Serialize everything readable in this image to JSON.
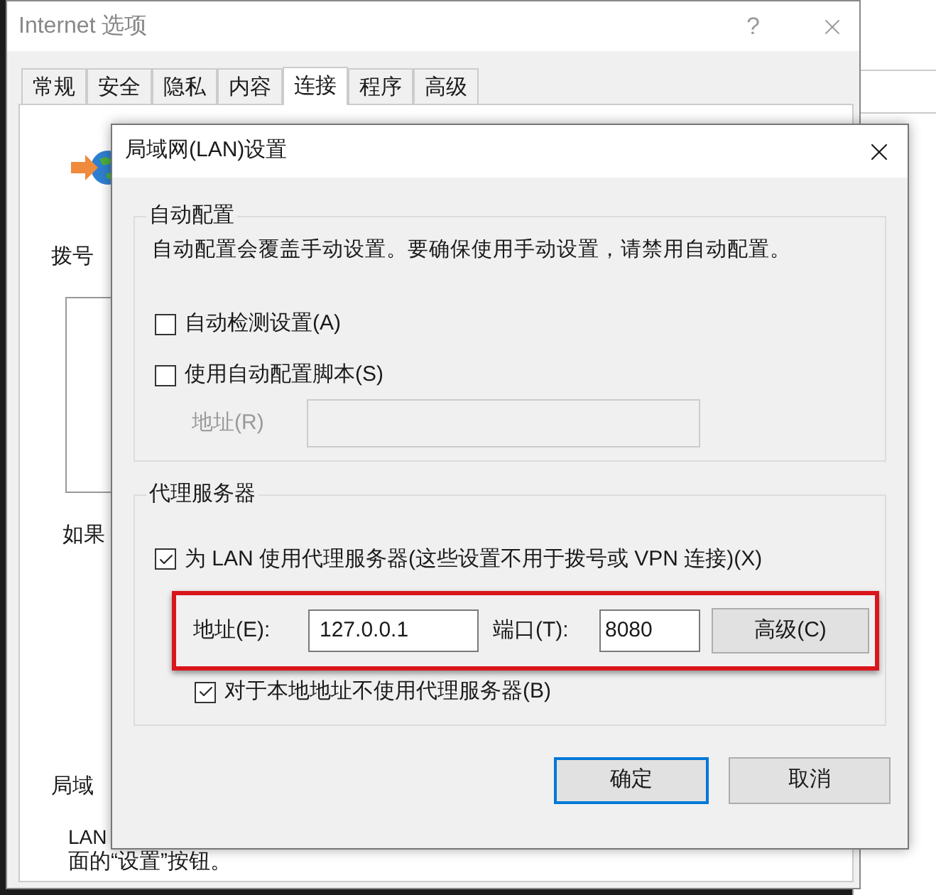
{
  "background_window": {
    "title": "Internet 选项",
    "help_button": "?",
    "tabs": [
      {
        "label": "常规",
        "selected": false
      },
      {
        "label": "安全",
        "selected": false
      },
      {
        "label": "隐私",
        "selected": false
      },
      {
        "label": "内容",
        "selected": false
      },
      {
        "label": "连接",
        "selected": true
      },
      {
        "label": "程序",
        "selected": false
      },
      {
        "label": "高级",
        "selected": false
      }
    ],
    "texts": {
      "dialup": "拨号",
      "if": "如果",
      "lan_heading": "局域",
      "lan_line_1": "LAN",
      "lan_line_2": "面的“设置”按钮。"
    }
  },
  "dialog": {
    "title": "局域网(LAN)设置",
    "auto_config": {
      "legend": "自动配置",
      "description": "自动配置会覆盖手动设置。要确保使用手动设置，请禁用自动配置。",
      "options": [
        {
          "label": "自动检测设置(A)",
          "checked": false
        },
        {
          "label": "使用自动配置脚本(S)",
          "checked": false
        }
      ],
      "address": {
        "label": "地址(R)",
        "disabled": true
      }
    },
    "proxy": {
      "legend": "代理服务器",
      "use_proxy": {
        "label": "为 LAN 使用代理服务器(这些设置不用于拨号或 VPN 连接)(X)",
        "checked": true
      },
      "address_label": "地址(E):",
      "address": "127.0.0.1",
      "port_label": "端口(T):",
      "port": "8080",
      "advanced_button": "高级(C)",
      "bypass_local": {
        "label": "对于本地地址不使用代理服务器(B)",
        "checked": true
      }
    },
    "buttons": [
      {
        "label": "确定",
        "default": true
      },
      {
        "label": "取消",
        "default": false
      }
    ]
  }
}
